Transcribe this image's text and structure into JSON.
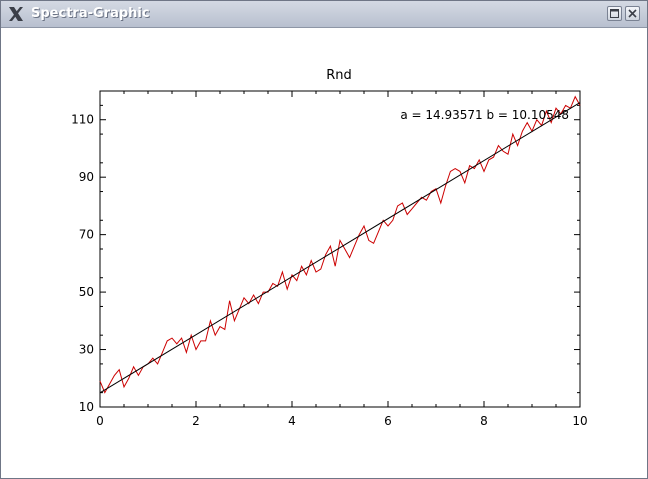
{
  "window": {
    "title": "Spectra-Graphic",
    "icons": [
      "x-logo-icon",
      "maximize-icon",
      "close-icon"
    ]
  },
  "chart_data": {
    "type": "line",
    "title": "Rnd",
    "xlabel": "",
    "ylabel": "",
    "xlim": [
      0,
      10
    ],
    "ylim": [
      10,
      120
    ],
    "x_ticks": [
      "0",
      "2",
      "4",
      "6",
      "8",
      "10"
    ],
    "y_ticks": [
      "10",
      "30",
      "50",
      "70",
      "90",
      "110"
    ],
    "grid": false,
    "annotation": "a = 14.93571 b = 10.10548",
    "fit_line": {
      "a": 14.93571,
      "b": 10.10548,
      "color": "#000000"
    },
    "series": [
      {
        "color": "#cc0000",
        "x": [
          0,
          0.1,
          0.2,
          0.3,
          0.4,
          0.5,
          0.6,
          0.7,
          0.8,
          0.9,
          1.0,
          1.1,
          1.2,
          1.3,
          1.4,
          1.5,
          1.6,
          1.7,
          1.8,
          1.9,
          2.0,
          2.1,
          2.2,
          2.3,
          2.4,
          2.5,
          2.6,
          2.7,
          2.8,
          2.9,
          3.0,
          3.1,
          3.2,
          3.3,
          3.4,
          3.5,
          3.6,
          3.7,
          3.8,
          3.9,
          4.0,
          4.1,
          4.2,
          4.3,
          4.4,
          4.5,
          4.6,
          4.7,
          4.8,
          4.9,
          5.0,
          5.1,
          5.2,
          5.3,
          5.4,
          5.5,
          5.6,
          5.7,
          5.8,
          5.9,
          6.0,
          6.1,
          6.2,
          6.3,
          6.4,
          6.5,
          6.6,
          6.7,
          6.8,
          6.9,
          7.0,
          7.1,
          7.2,
          7.3,
          7.4,
          7.5,
          7.6,
          7.7,
          7.8,
          7.9,
          8.0,
          8.1,
          8.2,
          8.3,
          8.4,
          8.5,
          8.6,
          8.7,
          8.8,
          8.9,
          9.0,
          9.1,
          9.2,
          9.3,
          9.4,
          9.5,
          9.6,
          9.7,
          9.8,
          9.9,
          10.0
        ],
        "y": [
          19,
          15,
          18,
          21,
          23,
          17,
          20,
          24,
          21,
          24,
          25,
          27,
          25,
          29,
          33,
          34,
          32,
          34,
          29,
          35,
          30,
          33,
          33,
          40,
          35,
          38,
          37,
          47,
          40,
          44,
          48,
          46,
          49,
          46,
          50,
          50,
          53,
          52,
          57,
          51,
          56,
          54,
          59,
          56,
          61,
          57,
          58,
          63,
          66,
          59,
          68,
          65,
          62,
          66,
          70,
          73,
          68,
          67,
          71,
          75,
          73,
          75,
          80,
          81,
          77,
          79,
          81,
          83,
          82,
          85,
          86,
          81,
          87,
          92,
          93,
          92,
          88,
          94,
          93,
          96,
          92,
          96,
          97,
          101,
          99,
          98,
          105,
          101,
          106,
          109,
          106,
          110,
          108,
          113,
          109,
          114,
          112,
          115,
          114,
          118,
          115
        ]
      }
    ]
  }
}
